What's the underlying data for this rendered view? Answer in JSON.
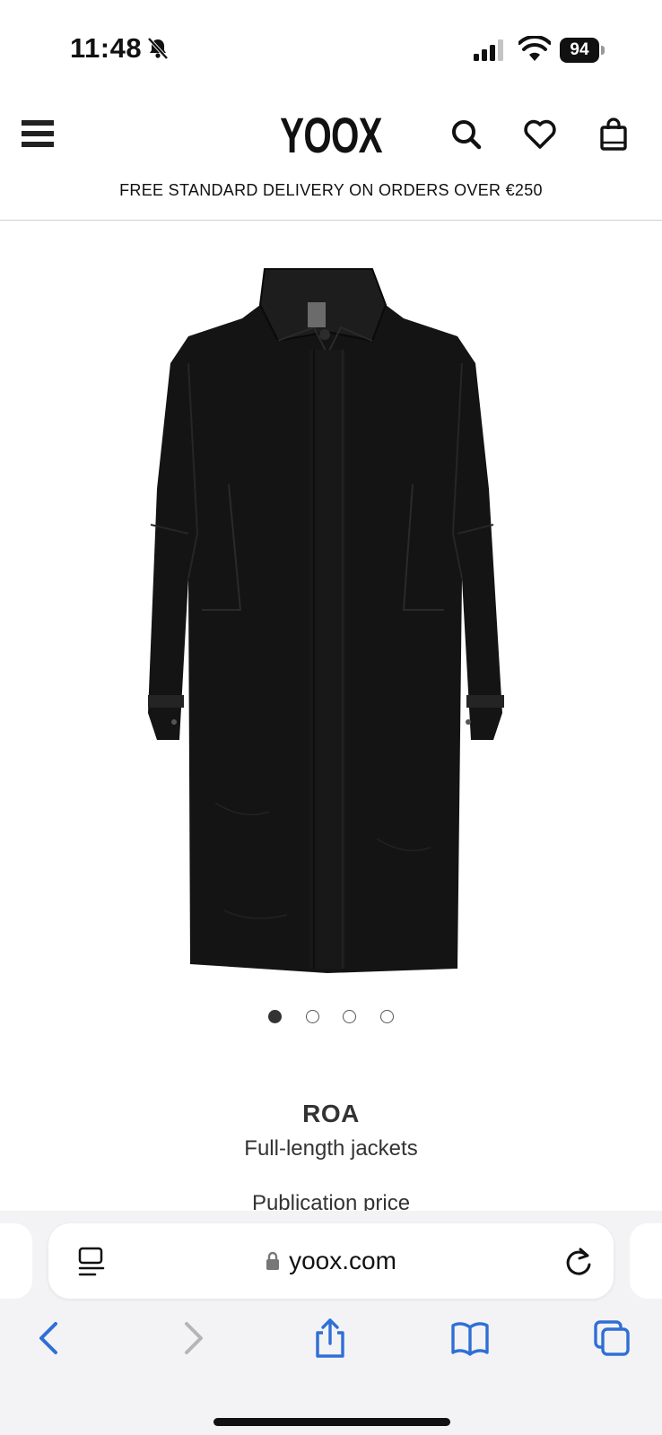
{
  "status_bar": {
    "time": "11:48",
    "battery_percent": "94",
    "icons": [
      "bell-slash-icon",
      "cellular-signal-icon",
      "wifi-icon",
      "battery-icon"
    ]
  },
  "header": {
    "logo": "YOOX",
    "promo": "FREE STANDARD DELIVERY ON ORDERS OVER €250",
    "icons": [
      "menu-icon",
      "search-icon",
      "heart-icon",
      "shopping-bag-icon"
    ]
  },
  "product": {
    "brand": "ROA",
    "category": "Full-length jackets",
    "price_label": "Publication price",
    "image_count": 4,
    "active_image_index": 1
  },
  "browser": {
    "url": "yoox.com",
    "icons": [
      "reader-icon",
      "lock-icon",
      "reload-icon",
      "back-icon",
      "forward-icon",
      "share-icon",
      "bookmarks-icon",
      "tabs-icon"
    ]
  },
  "colors": {
    "accent_blue": "#2f6fd6",
    "disabled_gray": "#b5b5b8",
    "text": "#111111",
    "safari_bar": "#f3f3f5"
  }
}
